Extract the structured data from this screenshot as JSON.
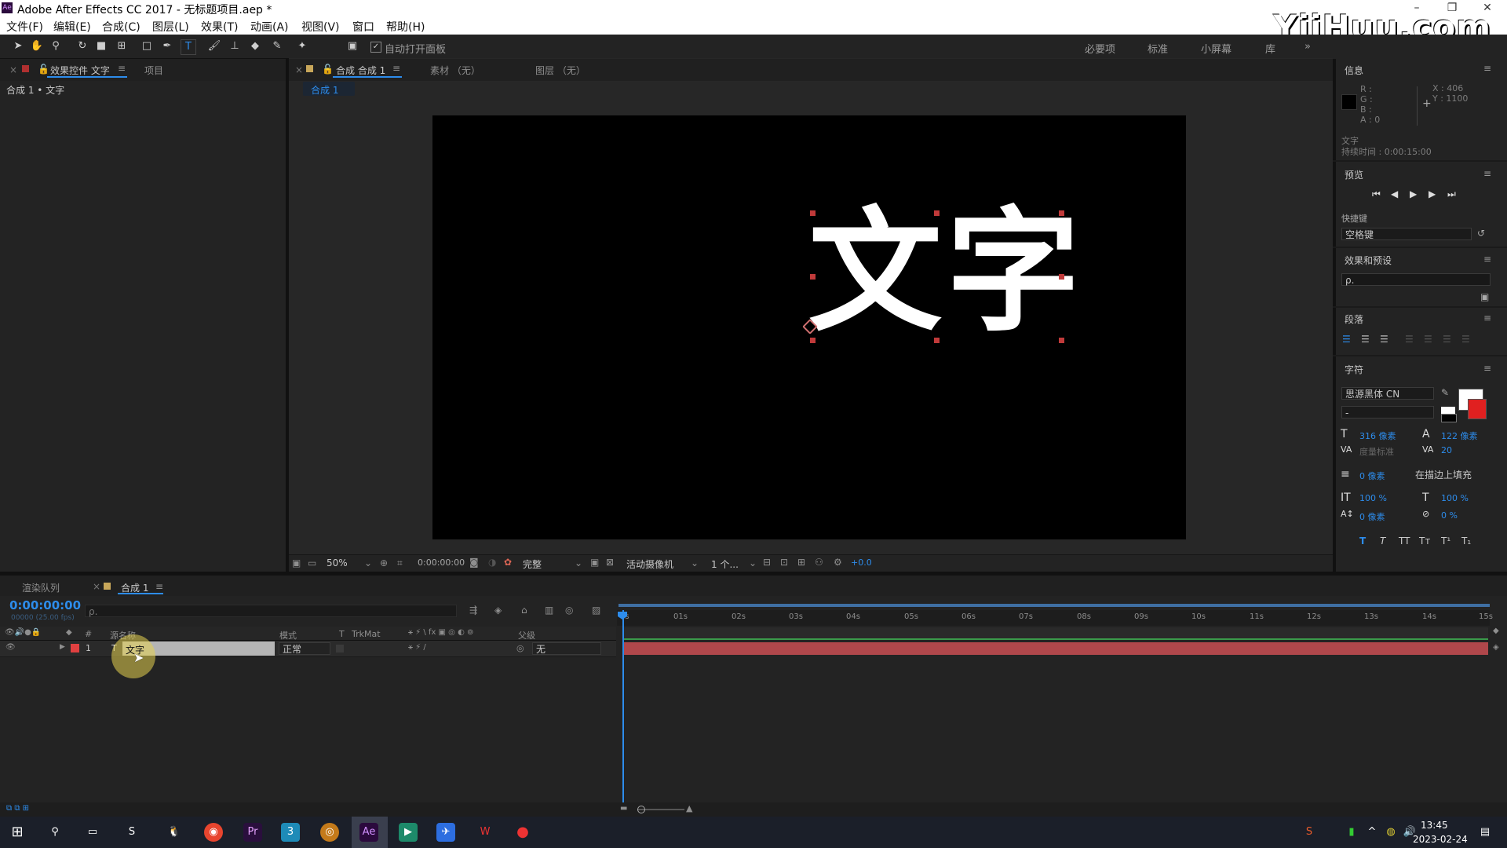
{
  "window": {
    "title": "Adobe After Effects CC 2017 - 无标题项目.aep *",
    "logo": "Ae"
  },
  "watermark": "YiiHuu.com",
  "menu": [
    "文件(F)",
    "编辑(E)",
    "合成(C)",
    "图层(L)",
    "效果(T)",
    "动画(A)",
    "视图(V)",
    "窗口",
    "帮助(H)"
  ],
  "toolbar": {
    "auto_open_label": "自动打开面板",
    "workspaces": [
      "必要项",
      "标准",
      "小屏幕",
      "库"
    ]
  },
  "left_panel": {
    "tab_effects": "效果控件 文字",
    "tab_project": "项目",
    "breadcrumb": "合成 1 • 文字"
  },
  "viewer": {
    "tab_comp": "合成 合成 1",
    "tab_footage": "素材 （无）",
    "tab_layer": "图层 （无）",
    "comp_chip": "合成 1",
    "text": "文字",
    "zoom": "50%",
    "timecode": "0:00:00:00",
    "resolution": "完整",
    "camera": "活动摄像机",
    "views": "1 个...",
    "exposure": "+0.0"
  },
  "info_panel": {
    "title": "信息",
    "r": "R :",
    "g": "G :",
    "b": "B :",
    "a": "A : 0",
    "x": "X : 406",
    "y": "Y : 1100",
    "layer_name": "文字",
    "duration": "持续时间 : 0:00:15:00"
  },
  "preview_panel": {
    "title": "预览",
    "shortcut_label": "快捷键",
    "shortcut_value": "空格键"
  },
  "effects_presets": {
    "title": "效果和预设",
    "search_placeholder": "ρ."
  },
  "paragraph": {
    "title": "段落"
  },
  "character": {
    "title": "字符",
    "font": "思源黑体 CN",
    "style": "-",
    "size": "316 像素",
    "leading": "122 像素",
    "kerning": "度量标准",
    "tracking": "20",
    "stroke": "0 像素",
    "stroke_mode": "在描边上填充",
    "vscale": "100 %",
    "hscale": "100 %",
    "baseline": "0 像素",
    "tsume": "0 %",
    "style_buttons": [
      "T",
      "T",
      "TT",
      "Tт",
      "T¹",
      "T₁"
    ]
  },
  "timeline": {
    "tab_render": "渲染队列",
    "tab_comp": "合成 1",
    "timecode": "0:00:00:00",
    "frames": "00000 (25.00 fps)",
    "search_placeholder": "ρ.",
    "col_num": "#",
    "col_source": "源名称",
    "col_mode": "模式",
    "col_t": "T",
    "col_trkmat": "TrkMat",
    "col_parent": "父级",
    "layer": {
      "num": "1",
      "name": "文字",
      "mode": "正常",
      "parent": "无"
    },
    "ruler": [
      "0s",
      "01s",
      "02s",
      "03s",
      "04s",
      "05s",
      "06s",
      "07s",
      "08s",
      "09s",
      "10s",
      "11s",
      "12s",
      "13s",
      "14s",
      "15s"
    ]
  },
  "taskbar": {
    "apps": [
      "⊞",
      "⚲",
      "▭",
      "S",
      "🐧",
      "◉",
      "Pr",
      "3",
      "◎",
      "Ae",
      "▶",
      "✈",
      "W",
      "●"
    ],
    "time": "13:45",
    "date": "2023-02-24"
  },
  "colors": {
    "accent": "#2d8ceb",
    "layer_bar": "#b0474b",
    "layer_label": "#e04040",
    "handle": "#c03a3a"
  }
}
